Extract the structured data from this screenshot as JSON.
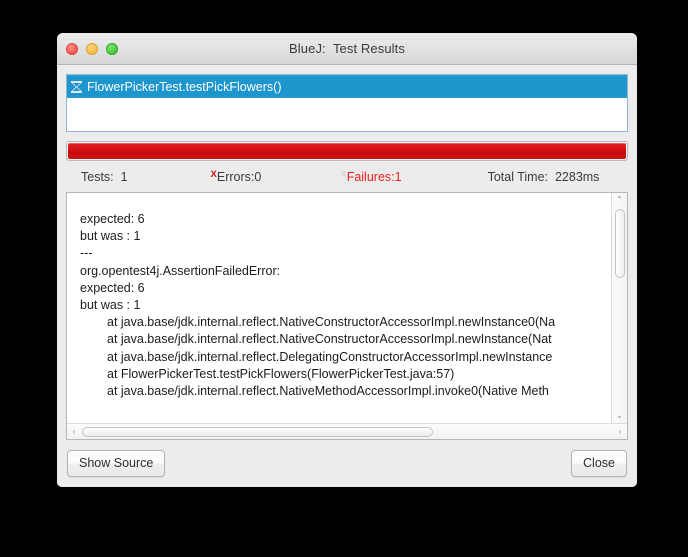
{
  "window": {
    "title": "BlueJ:  Test Results",
    "traffic_lights": [
      "close",
      "minimize",
      "maximize"
    ]
  },
  "test_list": {
    "items": [
      {
        "icon": "hourglass-icon",
        "label": "FlowerPickerTest.testPickFlowers()",
        "selected": true
      }
    ]
  },
  "progress": {
    "percent": 100,
    "color": "#d31111",
    "state": "failed"
  },
  "stats": {
    "tests_label": "Tests:  1",
    "errors_mark": "X",
    "errors_label": "Errors:0",
    "failures_mark": "X",
    "failures_label": "Failures:1",
    "time_label": "Total Time:  2283ms",
    "errors_color": "#cf1616",
    "failures_color": "#ef2020"
  },
  "trace": {
    "lines": [
      {
        "text": "expected: 6",
        "indent": false
      },
      {
        "text": "but was : 1",
        "indent": false
      },
      {
        "text": "---",
        "indent": false
      },
      {
        "text": "org.opentest4j.AssertionFailedError:",
        "indent": false
      },
      {
        "text": "expected: 6",
        "indent": false
      },
      {
        "text": "but was : 1",
        "indent": false
      },
      {
        "text": "at java.base/jdk.internal.reflect.NativeConstructorAccessorImpl.newInstance0(Na",
        "indent": true
      },
      {
        "text": "at java.base/jdk.internal.reflect.NativeConstructorAccessorImpl.newInstance(Nat",
        "indent": true
      },
      {
        "text": "at java.base/jdk.internal.reflect.DelegatingConstructorAccessorImpl.newInstance",
        "indent": true
      },
      {
        "text": "at FlowerPickerTest.testPickFlowers(FlowerPickerTest.java:57)",
        "indent": true
      },
      {
        "text": "at java.base/jdk.internal.reflect.NativeMethodAccessorImpl.invoke0(Native Meth",
        "indent": true
      }
    ],
    "vscroll": {
      "up": "⌃",
      "down": "⌄",
      "thumb_percent": 34
    },
    "hscroll": {
      "left": "‹",
      "right": "›",
      "thumb_percent": 66
    }
  },
  "footer": {
    "show_source_label": "Show Source",
    "close_label": "Close"
  }
}
